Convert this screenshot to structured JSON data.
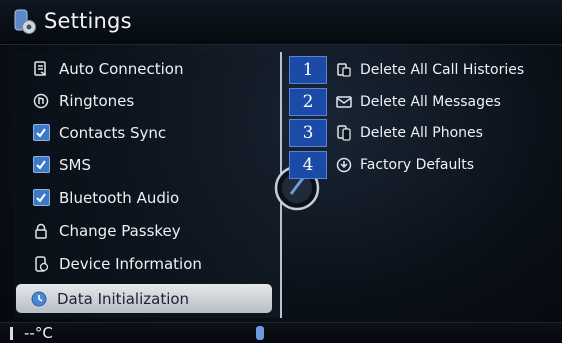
{
  "header": {
    "title": "Settings",
    "icon": "settings-gear-phone-icon"
  },
  "menu": {
    "items": [
      {
        "label": "Auto Connection",
        "icon": "auto-connection-icon",
        "type": "icon"
      },
      {
        "label": "Ringtones",
        "icon": "ringtone-icon",
        "type": "icon"
      },
      {
        "label": "Contacts Sync",
        "icon": "checkbox-checked-icon",
        "type": "check"
      },
      {
        "label": "SMS",
        "icon": "checkbox-checked-icon",
        "type": "check"
      },
      {
        "label": "Bluetooth Audio",
        "icon": "checkbox-checked-icon",
        "type": "check"
      },
      {
        "label": "Change Passkey",
        "icon": "lock-icon",
        "type": "icon"
      },
      {
        "label": "Device Information",
        "icon": "device-info-icon",
        "type": "icon"
      },
      {
        "label": "Data Initialization",
        "icon": "data-init-icon",
        "type": "icon",
        "selected": true
      }
    ]
  },
  "options": [
    {
      "number": "1",
      "label": "Delete All Call Histories",
      "icon": "call-history-icon"
    },
    {
      "number": "2",
      "label": "Delete All Messages",
      "icon": "messages-icon"
    },
    {
      "number": "3",
      "label": "Delete All Phones",
      "icon": "phones-icon"
    },
    {
      "number": "4",
      "label": "Factory Defaults",
      "icon": "factory-defaults-icon"
    }
  ],
  "status": {
    "temperature": "--°C"
  },
  "colors": {
    "accent": "#1c4aa8",
    "check": "#3c79c9",
    "selected_bg": "#d4d8dd"
  }
}
